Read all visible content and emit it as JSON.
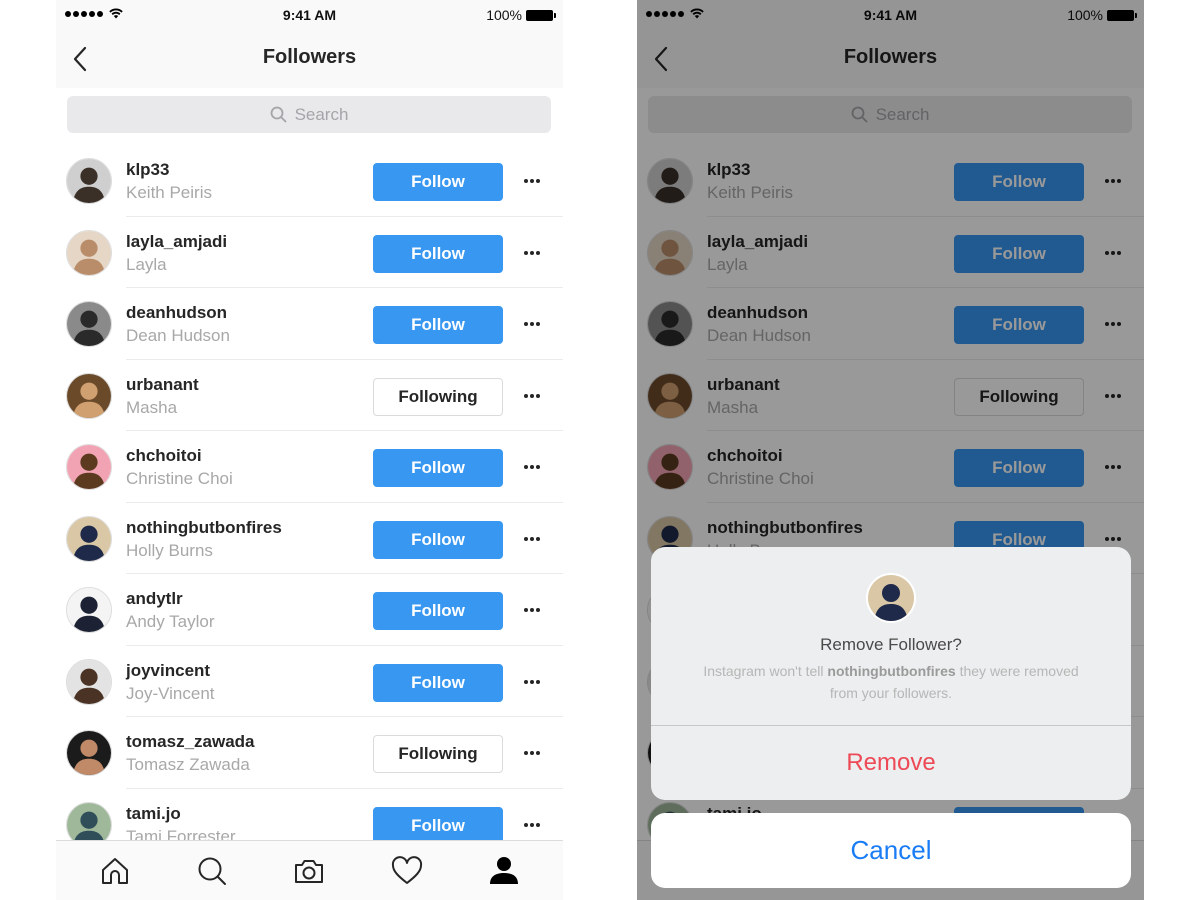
{
  "status_bar": {
    "time": "9:41 AM",
    "battery": "100%",
    "signal_icon": "signal-dots-icon",
    "wifi_icon": "wifi-icon",
    "battery_icon": "battery-icon"
  },
  "nav": {
    "title": "Followers",
    "back_icon": "chevron-left-icon"
  },
  "search": {
    "placeholder": "Search",
    "icon": "search-icon"
  },
  "colors": {
    "follow_button": "#3897f0",
    "remove": "#ed4956",
    "cancel": "#1a7cf5",
    "overlay": "rgba(0,0,0,0.40)"
  },
  "followers": [
    {
      "username": "klp33",
      "full_name": "Keith Peiris",
      "button": "Follow",
      "state": "follow",
      "avatar_bg": "#cfcfcf",
      "avatar_fg": "#3a3028"
    },
    {
      "username": "layla_amjadi",
      "full_name": "Layla",
      "button": "Follow",
      "state": "follow",
      "avatar_bg": "#e5d6c5",
      "avatar_fg": "#b98d6a"
    },
    {
      "username": "deanhudson",
      "full_name": "Dean Hudson",
      "button": "Follow",
      "state": "follow",
      "avatar_bg": "#8a8a8a",
      "avatar_fg": "#2a2a2a"
    },
    {
      "username": "urbanant",
      "full_name": "Masha",
      "button": "Following",
      "state": "following",
      "avatar_bg": "#6b4a2a",
      "avatar_fg": "#d1a070"
    },
    {
      "username": "chchoitoi",
      "full_name": "Christine Choi",
      "button": "Follow",
      "state": "follow",
      "avatar_bg": "#f2a3b3",
      "avatar_fg": "#5b3a20"
    },
    {
      "username": "nothingbutbonfires",
      "full_name": "Holly Burns",
      "button": "Follow",
      "state": "follow",
      "avatar_bg": "#d9c7a5",
      "avatar_fg": "#1f2a4a"
    },
    {
      "username": "andytlr",
      "full_name": "Andy Taylor",
      "button": "Follow",
      "state": "follow",
      "avatar_bg": "#f4f4f4",
      "avatar_fg": "#1c2233"
    },
    {
      "username": "joyvincent",
      "full_name": "Joy-Vincent",
      "button": "Follow",
      "state": "follow",
      "avatar_bg": "#e3e3e3",
      "avatar_fg": "#4a3224"
    },
    {
      "username": "tomasz_zawada",
      "full_name": "Tomasz Zawada",
      "button": "Following",
      "state": "following",
      "avatar_bg": "#1b1b1b",
      "avatar_fg": "#c08a68"
    },
    {
      "username": "tami.jo",
      "full_name": "Tami Forrester",
      "button": "Follow",
      "state": "follow",
      "avatar_bg": "#9fb89a",
      "avatar_fg": "#2f4e5a"
    }
  ],
  "more_icon": "more-horizontal-icon",
  "tab_bar": [
    {
      "name": "home",
      "icon": "home-icon"
    },
    {
      "name": "search",
      "icon": "search-icon"
    },
    {
      "name": "camera",
      "icon": "camera-icon"
    },
    {
      "name": "activity",
      "icon": "heart-icon"
    },
    {
      "name": "profile",
      "icon": "profile-icon",
      "active": true
    }
  ],
  "action_sheet": {
    "title": "Remove Follower?",
    "message_prefix": "Instagram won't tell ",
    "message_username": "nothingbutbonfires",
    "message_suffix": " they were removed from your followers.",
    "remove_label": "Remove",
    "cancel_label": "Cancel"
  }
}
